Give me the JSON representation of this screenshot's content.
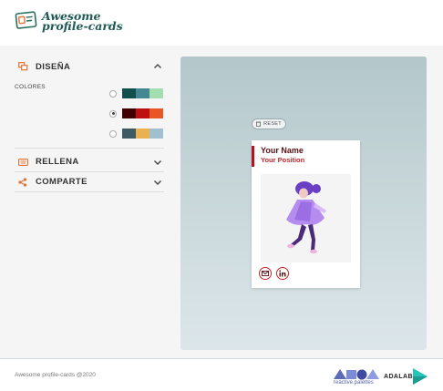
{
  "header": {
    "logo_line1": "Awesome",
    "logo_line2": "profile-cards"
  },
  "panel": {
    "design": {
      "title": "DISEÑA",
      "icon": "layers-icon",
      "expanded": true
    },
    "colors_label": "COLORES",
    "palettes": [
      {
        "colors": [
          "#114e4e",
          "#438792",
          "#a2deaf"
        ],
        "selected": false
      },
      {
        "colors": [
          "#420101",
          "#bd1010",
          "#e95626"
        ],
        "selected": true
      },
      {
        "colors": [
          "#3e5b65",
          "#eab052",
          "#a0c0cf"
        ],
        "selected": false
      }
    ],
    "fill": {
      "title": "RELLENA",
      "icon": "keyboard-icon",
      "expanded": false
    },
    "share": {
      "title": "COMPARTE",
      "icon": "share-icon",
      "expanded": false
    }
  },
  "preview": {
    "reset_label": "RESET",
    "card": {
      "name": "Your Name",
      "position": "Your Position",
      "social": [
        "email-icon",
        "linkedin-icon"
      ]
    }
  },
  "footer": {
    "copyright": "Awesome profile-cards @2020",
    "partner_logo_text": "reactive.palettes",
    "adalab_text": "ADALAB"
  },
  "colors": {
    "accent": "#e17334",
    "card_name": "#5a0f14",
    "card_position": "#c1272d",
    "card_border": "#b5121b"
  }
}
